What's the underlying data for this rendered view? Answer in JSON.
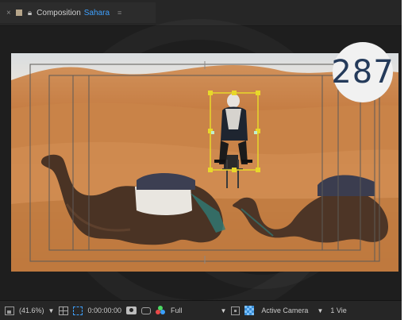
{
  "tab": {
    "close": "×",
    "lock": "ก",
    "prefix": "Composition",
    "comp_name": "Sahara",
    "menu": "≡"
  },
  "badge": "287",
  "status": {
    "zoom": "(41.6%)",
    "timecode": "0:00:00:00",
    "resolution": "Full",
    "view": "Active Camera",
    "views": "1 Vie"
  },
  "colors": {
    "comp_name": "#3fa1ff",
    "selection": "#e8d82a",
    "badge_text": "#243a5a"
  },
  "icons": {
    "tab_close": "close-icon",
    "tab_color": "label-color-swatch",
    "tab_lock": "lock-icon",
    "tab_menu": "panel-menu-icon",
    "res": "resolution-icon",
    "zoom_caret": "chevron-down-icon",
    "grid": "grid-icon",
    "mask": "mask-visibility-icon",
    "snapshot": "camera-snapshot-icon",
    "link": "show-snapshot-icon",
    "channels": "rgb-channels-icon",
    "region": "region-of-interest-icon",
    "transparency": "transparency-grid-icon"
  }
}
